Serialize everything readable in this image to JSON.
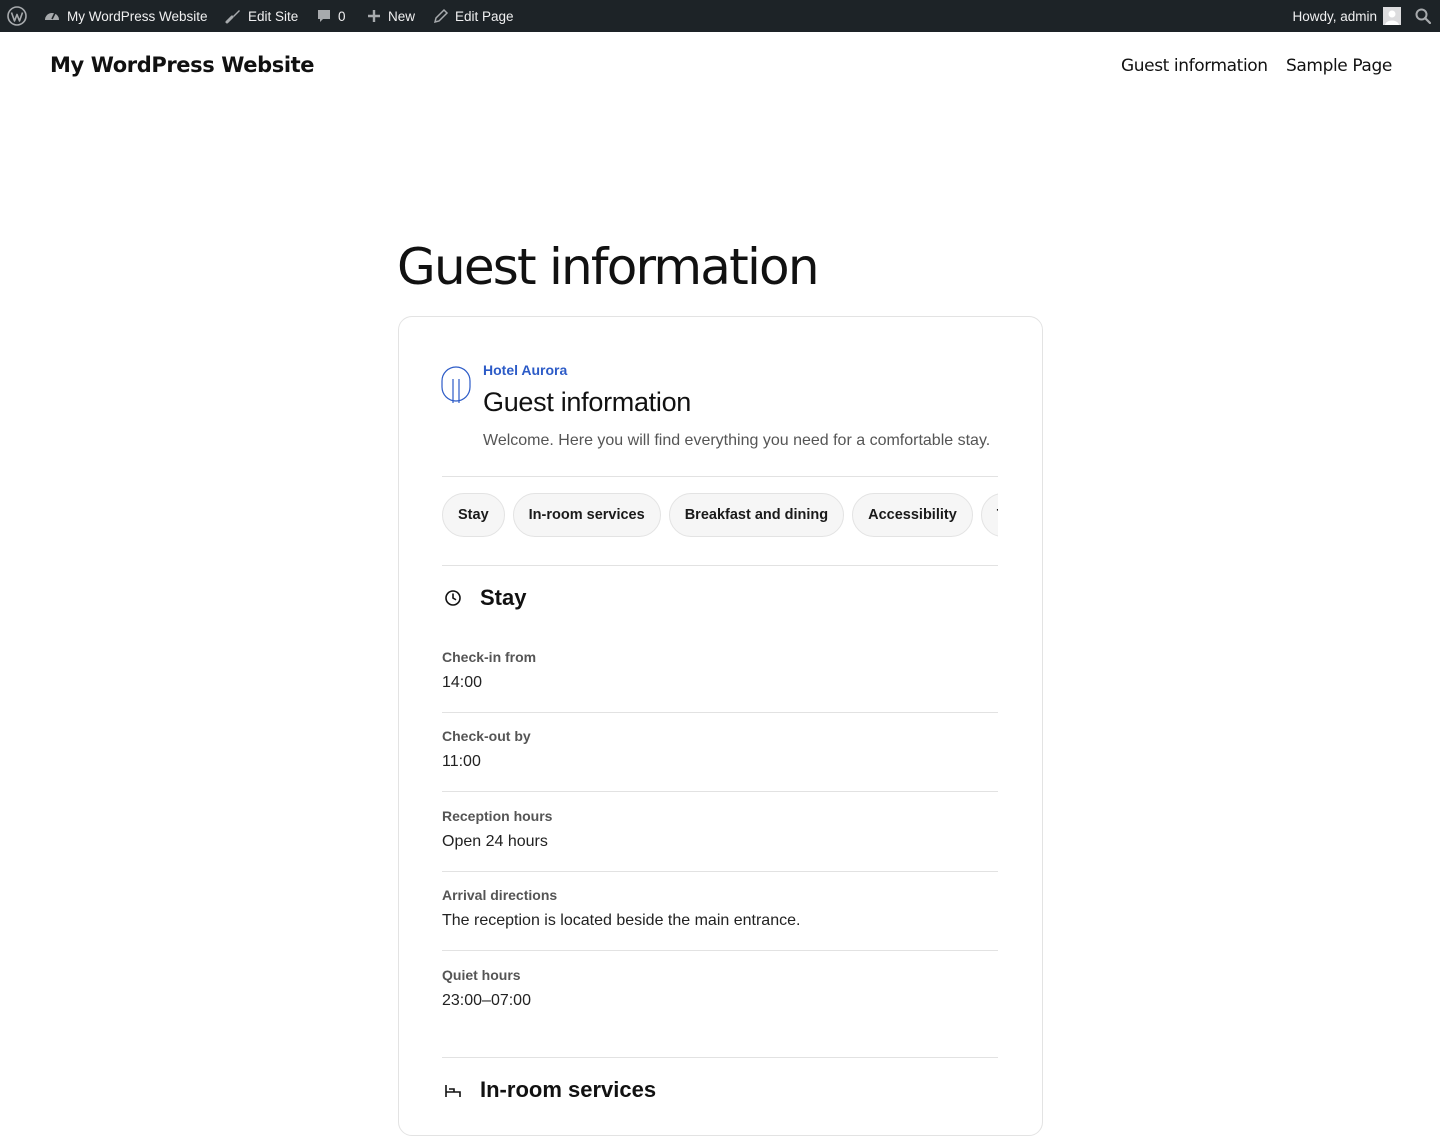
{
  "admin_bar": {
    "site_name": "My WordPress Website",
    "edit_site": "Edit Site",
    "comments_count": "0",
    "new_label": "New",
    "edit_page": "Edit Page",
    "greeting": "Howdy, admin"
  },
  "header": {
    "site_title": "My WordPress Website",
    "nav": [
      "Guest information",
      "Sample Page"
    ]
  },
  "page": {
    "title": "Guest information"
  },
  "card": {
    "hotel_name": "Hotel Aurora",
    "title": "Guest information",
    "intro": "Welcome. Here you will find everything you need for a comfortable stay.",
    "tabs": [
      "Stay",
      "In-room services",
      "Breakfast and dining",
      "Accessibility",
      "Tra"
    ],
    "sections": [
      {
        "title": "Stay",
        "icon": "clock-icon",
        "items": [
          {
            "label": "Check-in from",
            "value": "14:00"
          },
          {
            "label": "Check-out by",
            "value": "11:00"
          },
          {
            "label": "Reception hours",
            "value": "Open 24 hours"
          },
          {
            "label": "Arrival directions",
            "value": "The reception is located beside the main entrance."
          },
          {
            "label": "Quiet hours",
            "value": "23:00–07:00"
          }
        ]
      },
      {
        "title": "In-room services",
        "icon": "bed-icon",
        "items": []
      }
    ]
  },
  "colors": {
    "admin_bar_bg": "#1d2327",
    "accent": "#2c5bc7",
    "card_border": "#e3e3e3"
  }
}
